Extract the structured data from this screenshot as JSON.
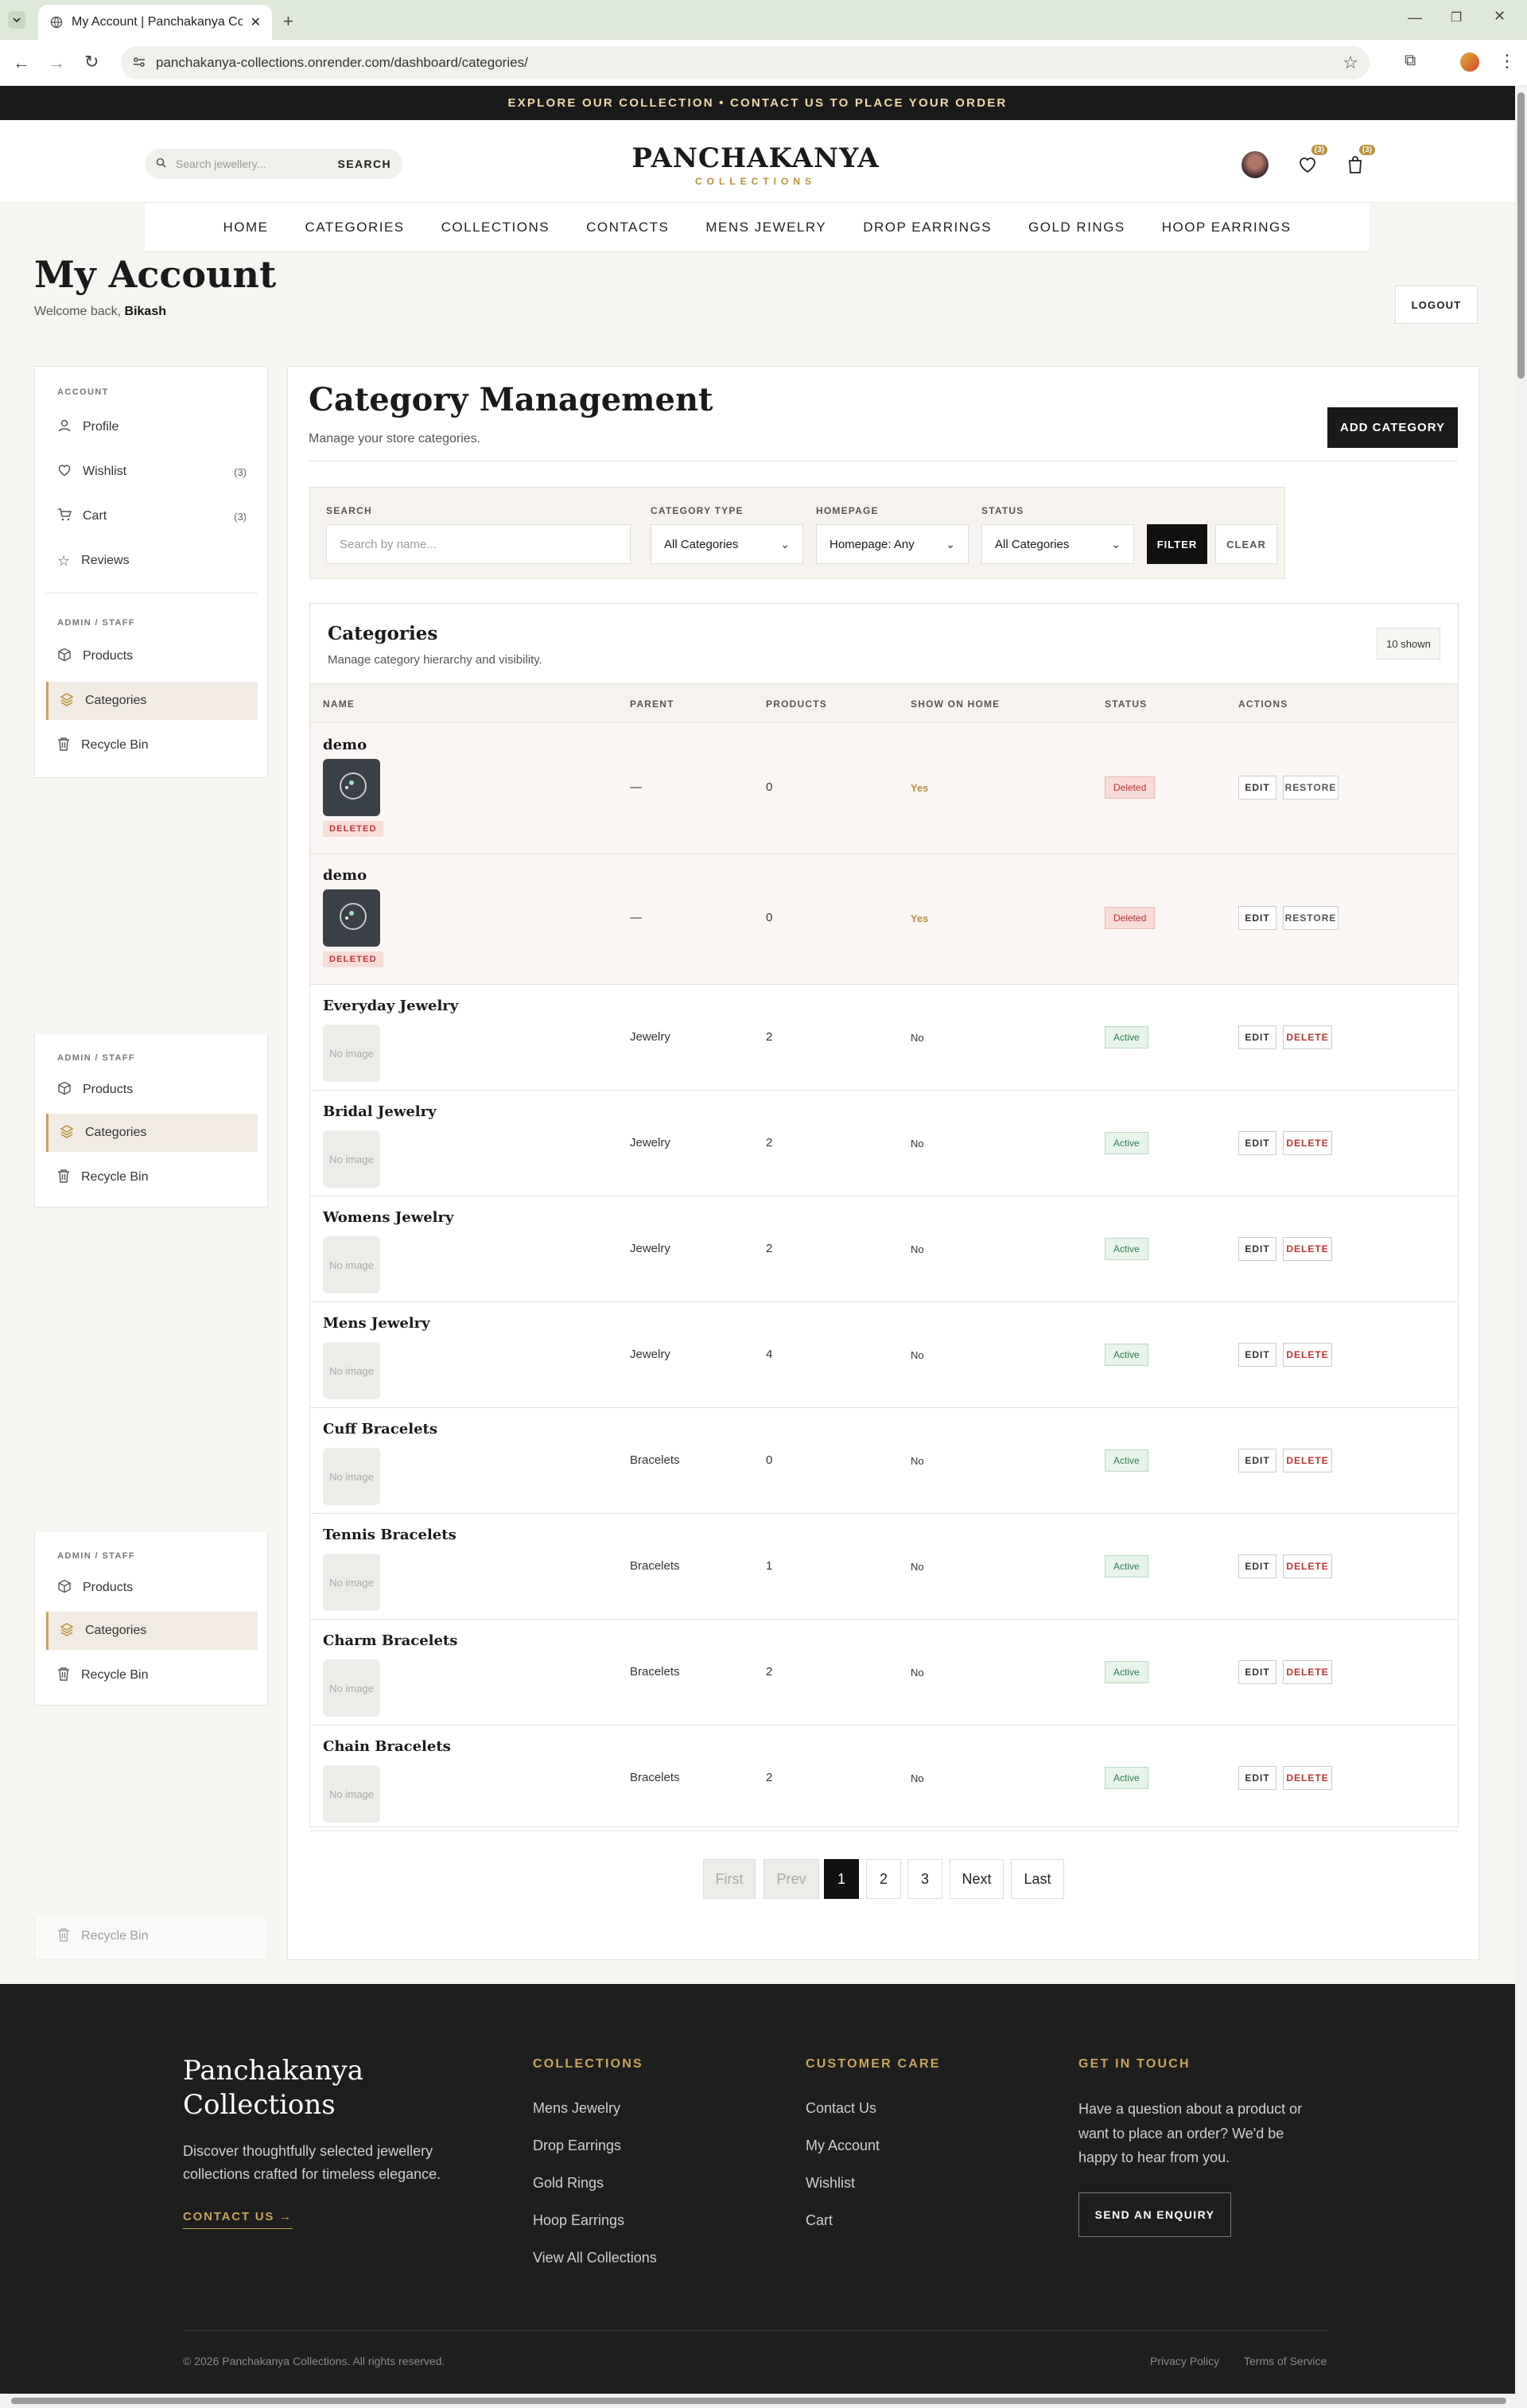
{
  "browser": {
    "tab_title": "My Account | Panchakanya Coll",
    "url": "panchakanya-collections.onrender.com/dashboard/categories/"
  },
  "site": {
    "announcement": "EXPLORE OUR COLLECTION • CONTACT US TO PLACE YOUR ORDER",
    "search_placeholder": "Search jewellery...",
    "search_button": "SEARCH",
    "logo_main": "PANCHAKANYA",
    "logo_sub": "COLLECTIONS",
    "wishlist_count": "(3)",
    "cart_count": "(3)",
    "nav": [
      "HOME",
      "CATEGORIES",
      "COLLECTIONS",
      "CONTACTS",
      "MENS JEWELRY",
      "DROP EARRINGS",
      "GOLD RINGS",
      "HOOP EARRINGS"
    ]
  },
  "account": {
    "title": "My Account",
    "welcome": "Welcome back,",
    "user": "Bikash",
    "logout": "LOGOUT"
  },
  "sidebar": {
    "account_label": "ACCOUNT",
    "admin_label": "ADMIN / STAFF",
    "profile": "Profile",
    "wishlist": "Wishlist",
    "wishlist_count": "(3)",
    "cart": "Cart",
    "cart_count": "(3)",
    "reviews": "Reviews",
    "products": "Products",
    "categories": "Categories",
    "recycle": "Recycle Bin"
  },
  "page": {
    "title": "Category Management",
    "subtitle": "Manage your store categories.",
    "add_button": "ADD CATEGORY"
  },
  "filters": {
    "search_label": "SEARCH",
    "search_placeholder": "Search by name...",
    "type_label": "CATEGORY TYPE",
    "type_value": "All Categories",
    "home_label": "HOMEPAGE",
    "home_value": "Homepage: Any",
    "status_label": "STATUS",
    "status_value": "All Categories",
    "filter_btn": "FILTER",
    "clear_btn": "CLEAR"
  },
  "table": {
    "title": "Categories",
    "subtitle": "Manage category hierarchy and visibility.",
    "shown": "10 shown",
    "headers": [
      "NAME",
      "PARENT",
      "PRODUCTS",
      "SHOW ON HOME",
      "STATUS",
      "ACTIONS"
    ],
    "deleted_tag": "DELETED",
    "no_image": "No image",
    "edit": "EDIT",
    "restore": "RESTORE",
    "delete": "DELETE",
    "rows": [
      {
        "name": "demo",
        "parent": "—",
        "products": "0",
        "home": "Yes",
        "status": "Deleted",
        "deleted": true
      },
      {
        "name": "demo",
        "parent": "—",
        "products": "0",
        "home": "Yes",
        "status": "Deleted",
        "deleted": true
      },
      {
        "name": "Everyday Jewelry",
        "parent": "Jewelry",
        "products": "2",
        "home": "No",
        "status": "Active",
        "deleted": false
      },
      {
        "name": "Bridal Jewelry",
        "parent": "Jewelry",
        "products": "2",
        "home": "No",
        "status": "Active",
        "deleted": false
      },
      {
        "name": "Womens Jewelry",
        "parent": "Jewelry",
        "products": "2",
        "home": "No",
        "status": "Active",
        "deleted": false
      },
      {
        "name": "Mens Jewelry",
        "parent": "Jewelry",
        "products": "4",
        "home": "No",
        "status": "Active",
        "deleted": false
      },
      {
        "name": "Cuff Bracelets",
        "parent": "Bracelets",
        "products": "0",
        "home": "No",
        "status": "Active",
        "deleted": false
      },
      {
        "name": "Tennis Bracelets",
        "parent": "Bracelets",
        "products": "1",
        "home": "No",
        "status": "Active",
        "deleted": false
      },
      {
        "name": "Charm Bracelets",
        "parent": "Bracelets",
        "products": "2",
        "home": "No",
        "status": "Active",
        "deleted": false
      },
      {
        "name": "Chain Bracelets",
        "parent": "Bracelets",
        "products": "2",
        "home": "No",
        "status": "Active",
        "deleted": false
      }
    ]
  },
  "pagination": [
    "First",
    "Prev",
    "1",
    "2",
    "3",
    "Next",
    "Last"
  ],
  "footer": {
    "brand_line1": "Panchakanya",
    "brand_line2": "Collections",
    "desc_line1": "Discover thoughtfully selected jewellery",
    "desc_line2": "collections crafted for timeless elegance.",
    "contact_link": "CONTACT US →",
    "col1_title": "COLLECTIONS",
    "col1": [
      "Mens Jewelry",
      "Drop Earrings",
      "Gold Rings",
      "Hoop Earrings",
      "View All Collections"
    ],
    "col2_title": "CUSTOMER CARE",
    "col2": [
      "Contact Us",
      "My Account",
      "Wishlist",
      "Cart"
    ],
    "col3_title": "GET IN TOUCH",
    "col3_line1": "Have a question about a product or",
    "col3_line2": "want to place an order? We'd be",
    "col3_line3": "happy to hear from you.",
    "enquiry": "SEND AN ENQUIRY",
    "copyright": "© 2026 Panchakanya Collections. All rights reserved.",
    "privacy": "Privacy Policy",
    "terms": "Terms of Service"
  }
}
